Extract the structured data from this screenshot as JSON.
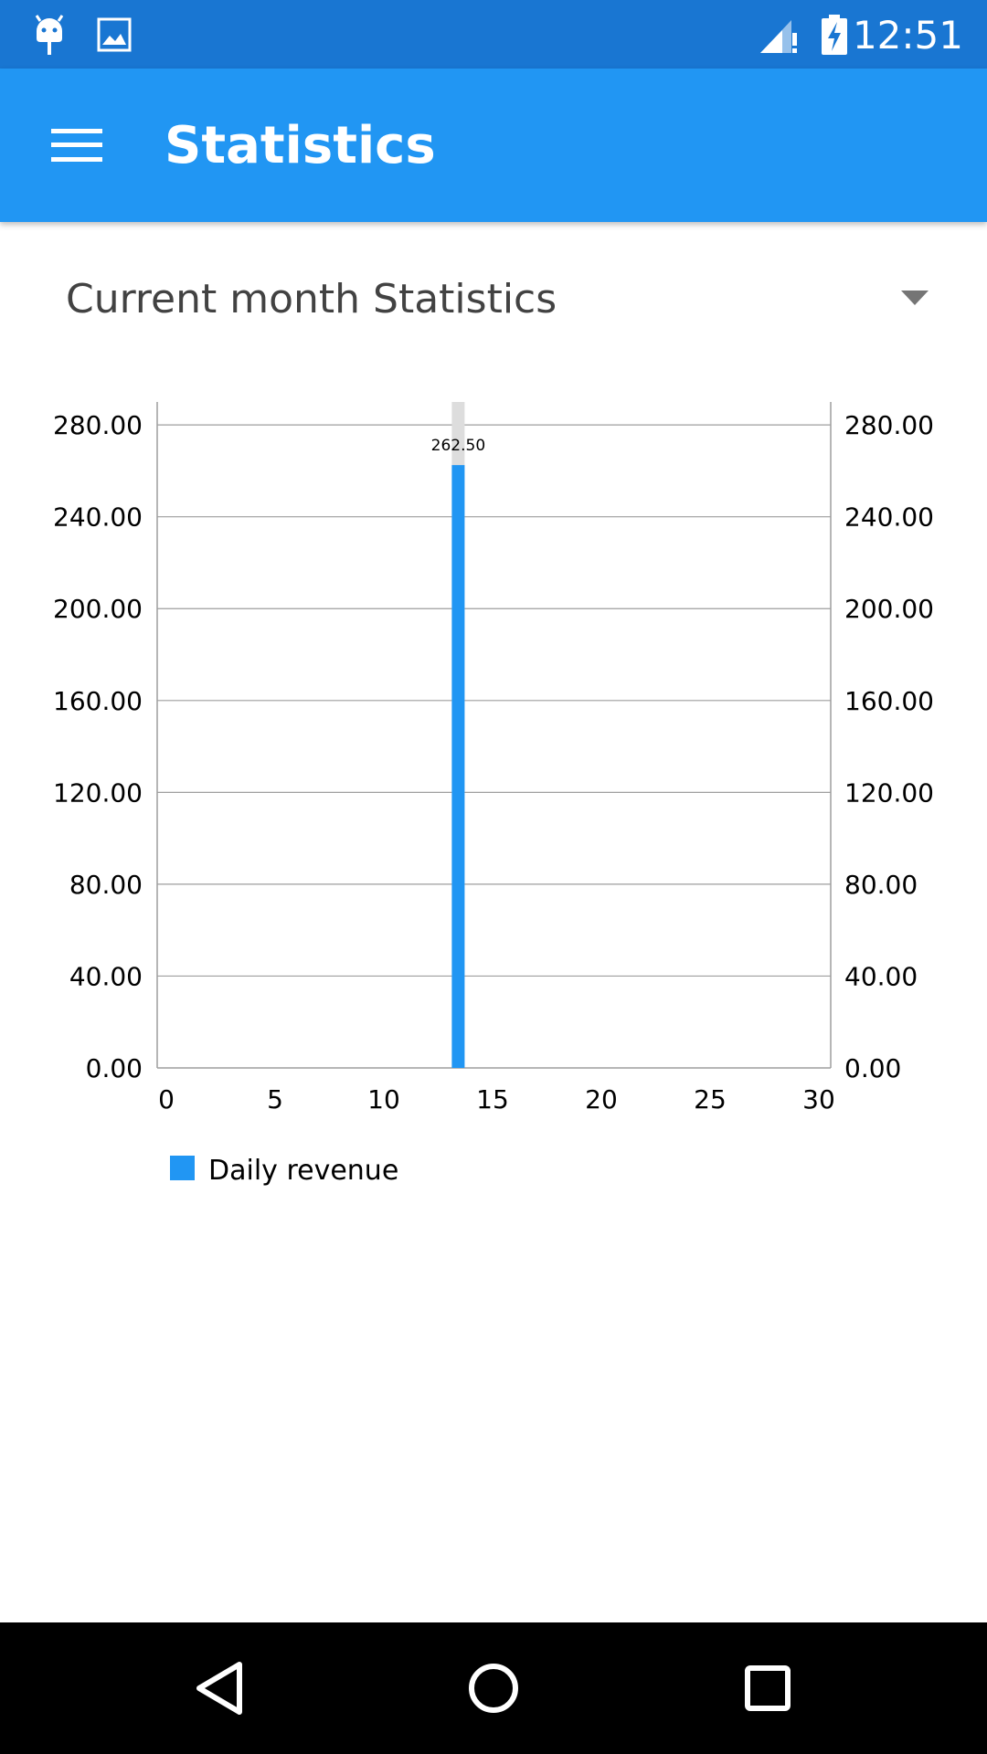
{
  "status_bar": {
    "time": "12:51",
    "left_icons": [
      "android-debug-icon",
      "image-icon"
    ],
    "right_icons": [
      "signal-icon",
      "battery-charging-icon"
    ]
  },
  "app_bar": {
    "title": "Statistics",
    "menu_icon": "hamburger-menu-icon",
    "color": "#2196F3"
  },
  "spinner": {
    "selected": "Current month Statistics"
  },
  "chart_data": {
    "type": "bar",
    "x": [
      13
    ],
    "series": [
      {
        "name": "Daily revenue",
        "values": [
          262.5
        ],
        "color": "#2196F3",
        "labels": [
          "262.50"
        ]
      }
    ],
    "highlight_index": 0,
    "y_ticks_left": [
      "0.00",
      "40.00",
      "80.00",
      "120.00",
      "160.00",
      "200.00",
      "240.00",
      "280.00"
    ],
    "y_ticks_right": [
      "0.00",
      "40.00",
      "80.00",
      "120.00",
      "160.00",
      "200.00",
      "240.00",
      "280.00"
    ],
    "x_ticks": [
      "0",
      "5",
      "10",
      "15",
      "20",
      "25",
      "30"
    ],
    "xlim": [
      0,
      30
    ],
    "ylim": [
      0,
      290
    ],
    "grid": true,
    "legend": "bottom-left",
    "title": "",
    "xlabel": "",
    "ylabel": ""
  },
  "nav_bar": {
    "back_icon": "back-triangle-icon",
    "home_icon": "home-circle-icon",
    "recents_icon": "recents-square-icon"
  }
}
